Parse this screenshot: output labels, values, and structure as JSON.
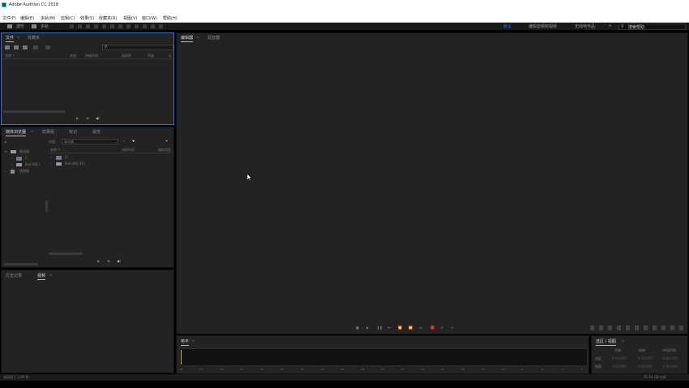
{
  "window": {
    "title": "Adobe Audition CC 2018"
  },
  "menu": [
    "文件(F)",
    "编辑(E)",
    "多轨(M)",
    "剪辑(C)",
    "效果(S)",
    "收藏夹(R)",
    "视图(V)",
    "窗口(W)",
    "帮助(H)"
  ],
  "toolbar": {
    "wave_label": "波形",
    "multitrack_label": "多轨",
    "workspaces": [
      "默认",
      "编辑音频到视频",
      "无线电作品"
    ],
    "search_placeholder": "搜索帮助"
  },
  "files_panel": {
    "tabs": [
      "文件",
      "收藏夹"
    ],
    "search_placeholder": "",
    "columns": [
      "名称 ↑",
      "状态",
      "持续时间",
      "采样率",
      "声道"
    ]
  },
  "browser_panel": {
    "tabs": [
      "媒体浏览器",
      "效果组",
      "标记",
      "属性"
    ],
    "content_label": "内容:",
    "content_value": "驱动器",
    "tree": [
      {
        "label": "驱动器",
        "expanded": true
      },
      {
        "label": "C:"
      },
      {
        "label": "Red WD ("
      },
      {
        "label": "快捷键"
      }
    ],
    "columns": [
      "名称 ↑",
      "持续时间",
      "媒体类型"
    ],
    "items": [
      "C:",
      "Red WD (D:)"
    ]
  },
  "history_panel": {
    "tabs": [
      "历史记录",
      "视频"
    ]
  },
  "editor_panel": {
    "tabs": [
      "编辑器",
      "混音器"
    ]
  },
  "levels_panel": {
    "tab": "电平",
    "ticks": [
      "dB",
      "-57",
      "-54",
      "-51",
      "-48",
      "-45",
      "-42",
      "-39",
      "-36",
      "-33",
      "-30",
      "-27",
      "-24",
      "-21",
      "-18",
      "-15",
      "-12",
      "-9",
      "-6",
      "-3",
      "0"
    ]
  },
  "selection_panel": {
    "tab": "选区 / 视图",
    "headers": [
      "开始",
      "结束",
      "持续时间"
    ],
    "rows": [
      {
        "label": "选区",
        "values": [
          "0:00.000",
          "0:00.000",
          "0:00.000"
        ]
      },
      {
        "label": "视图",
        "values": [
          "0:00.000",
          "0:00.000",
          "0:00.000"
        ]
      }
    ]
  },
  "status": {
    "left": "启动用了 3.90 秒",
    "right": "31.53 GB 空闲"
  },
  "colors": {
    "accent": "#2e78d0",
    "record": "#e0322f"
  }
}
